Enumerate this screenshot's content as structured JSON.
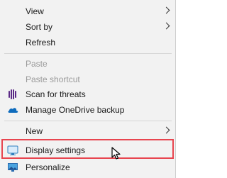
{
  "menu": {
    "items": [
      {
        "label": "View",
        "has_submenu": true
      },
      {
        "label": "Sort by",
        "has_submenu": true
      },
      {
        "label": "Refresh"
      },
      {
        "label": "Paste",
        "disabled": true
      },
      {
        "label": "Paste shortcut",
        "disabled": true
      },
      {
        "label": "Scan for threats",
        "icon": "antivirus-icon"
      },
      {
        "label": "Manage OneDrive backup",
        "icon": "onedrive-cloud-icon"
      },
      {
        "label": "New",
        "has_submenu": true
      },
      {
        "label": "Display settings",
        "icon": "display-monitor-icon",
        "highlighted": true
      },
      {
        "label": "Personalize",
        "icon": "personalize-monitor-icon"
      }
    ]
  },
  "colors": {
    "background": "#f2f2f2",
    "highlight_border": "#e8454f",
    "disabled_text": "#9a9a9a",
    "onedrive_blue": "#0f6cbd",
    "antivirus_purple": "#5b2a86"
  }
}
